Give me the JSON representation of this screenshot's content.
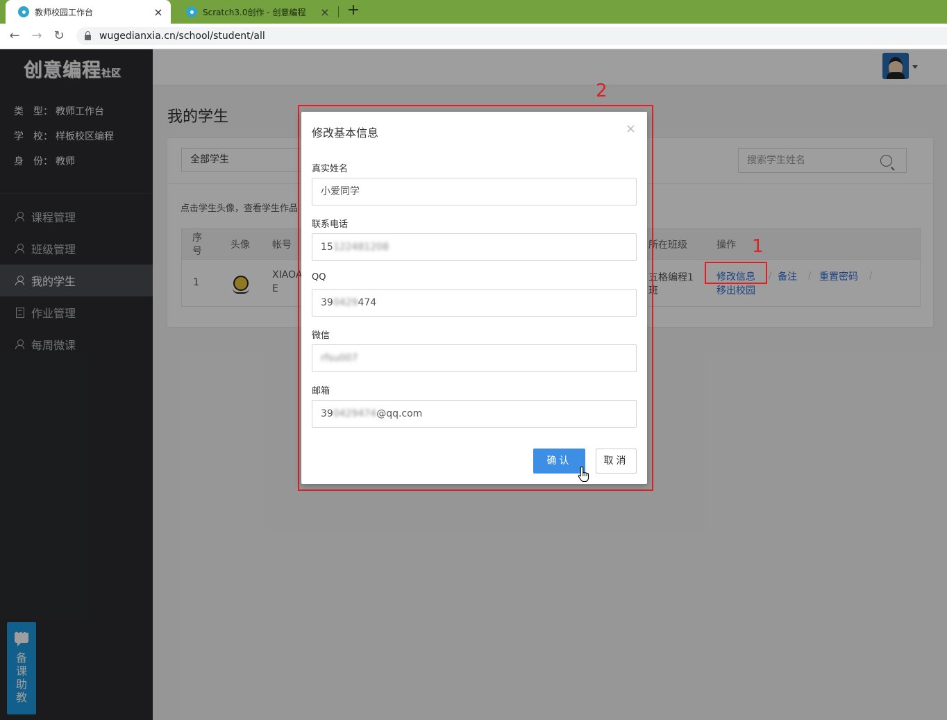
{
  "browser": {
    "tabs": [
      {
        "title": "教师校园工作台",
        "close": "×"
      },
      {
        "title": "Scratch3.0创作 - 创意编程",
        "close": "×"
      }
    ],
    "new_tab": "+",
    "url": "wugedianxia.cn/school/student/all",
    "nav": {
      "back": "←",
      "forward": "→",
      "reload": "↻"
    }
  },
  "sidebar": {
    "logo": "创意编程",
    "logo_suffix": "社区",
    "info": [
      {
        "label": "类　型：",
        "value": "教师工作台"
      },
      {
        "label": "学　校：",
        "value": "样板校区编程"
      },
      {
        "label": "身　份：",
        "value": "教师"
      }
    ],
    "menu": [
      {
        "label": "课程管理",
        "icon": "user-icon"
      },
      {
        "label": "班级管理",
        "icon": "user-icon"
      },
      {
        "label": "我的学生",
        "icon": "user-icon",
        "active": true
      },
      {
        "label": "作业管理",
        "icon": "document-icon"
      },
      {
        "label": "每周微课",
        "icon": "user-icon"
      }
    ],
    "helper": "备课助教"
  },
  "page": {
    "title": "我的学生",
    "filter_value": "全部学生",
    "search_placeholder": "搜索学生姓名",
    "hint": "点击学生头像，查看学生作品",
    "table": {
      "headers": {
        "index_1": "序",
        "index_2": "号",
        "avatar": "头像",
        "account": "帐号",
        "class": "所在班级",
        "ops": "操作"
      },
      "row": {
        "index": "1",
        "account_1": "XIAOA",
        "account_2": "E",
        "class_1": "五格编程1",
        "class_2": "班",
        "ops": {
          "edit": "修改信息",
          "note": "备注",
          "reset": "重置密码",
          "remove": "移出校园",
          "sep": "/"
        }
      }
    }
  },
  "modal": {
    "title": "修改基本信息",
    "close": "×",
    "fields": {
      "name_label": "真实姓名",
      "name_value": "小爱同学",
      "phone_label": "联系电话",
      "phone_prefix": "15",
      "phone_hidden": "122481208",
      "qq_label": "QQ",
      "qq_prefix": "39",
      "qq_hidden": "0429",
      "qq_suffix": "474",
      "wechat_label": "微信",
      "wechat_hidden": "rfsu007",
      "email_label": "邮箱",
      "email_prefix": "39",
      "email_hidden": "0429474",
      "email_suffix": "@qq.com"
    },
    "confirm": "确认",
    "cancel": "取消"
  },
  "annotations": {
    "box1": "1",
    "box2": "2",
    "color": "#e02020"
  }
}
